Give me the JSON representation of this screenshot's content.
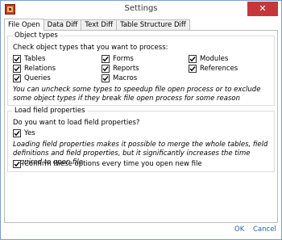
{
  "window": {
    "title": "Settings",
    "close_label": "✕"
  },
  "tabs": [
    {
      "label": "File Open",
      "active": true
    },
    {
      "label": "Data Diff",
      "active": false
    },
    {
      "label": "Text Diff",
      "active": false
    },
    {
      "label": "Table Structure Diff",
      "active": false
    }
  ],
  "object_types": {
    "title": "Object types",
    "prompt": "Check object types that you want to process:",
    "items": [
      {
        "label": "Tables",
        "checked": true
      },
      {
        "label": "Relations",
        "checked": true
      },
      {
        "label": "Queries",
        "checked": true
      },
      {
        "label": "Forms",
        "checked": true
      },
      {
        "label": "Reports",
        "checked": true
      },
      {
        "label": "Macros",
        "checked": true
      },
      {
        "label": "Modules",
        "checked": true
      },
      {
        "label": "References",
        "checked": true
      }
    ],
    "note": "You can uncheck some types to speedup file open process or to exclude some object types if they break file open process for some reason"
  },
  "load_field": {
    "title": "Load field properties",
    "question": "Do you want to load field properties?",
    "yes_label": "Yes",
    "yes_checked": true,
    "note": "Loading field properties makes it possible to merge the whole tables, field definitions and field properties, but it significantly increases the time required to open file"
  },
  "confirm": {
    "label": "Confirm these options every time you open new file",
    "checked": true
  },
  "buttons": {
    "ok": "OK",
    "cancel": "Cancel"
  },
  "colors": {
    "accent": "#2a5fb0",
    "close": "#c7373a"
  }
}
